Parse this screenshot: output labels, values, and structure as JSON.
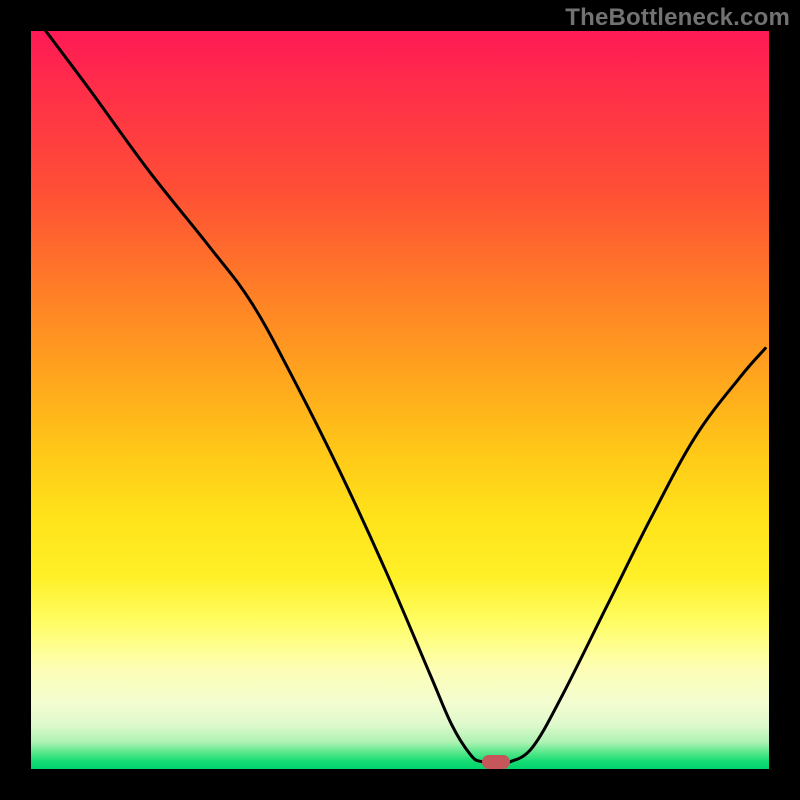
{
  "watermark": "TheBottleneck.com",
  "chart_data": {
    "type": "line",
    "title": "",
    "xlabel": "",
    "ylabel": "",
    "xlim": [
      0,
      100
    ],
    "ylim": [
      0,
      100
    ],
    "grid": false,
    "legend": false,
    "series": [
      {
        "name": "curve",
        "x": [
          2,
          8,
          16,
          24,
          30,
          36,
          42,
          48,
          54,
          57,
          59.5,
          61,
          63.5,
          65,
          68,
          72,
          78,
          84,
          90,
          96,
          99.5
        ],
        "y": [
          100,
          92,
          81,
          71,
          63,
          52,
          40,
          27,
          13,
          6,
          2,
          1,
          1,
          1,
          3,
          10,
          22,
          34,
          45,
          53,
          57
        ]
      }
    ],
    "marker": {
      "x": 63,
      "y": 1
    },
    "gradient_bands_percent_from_top": {
      "red": 0,
      "orange": 40,
      "yellow": 66,
      "pale_yellow": 82,
      "pale_green": 94,
      "green": 100
    }
  }
}
